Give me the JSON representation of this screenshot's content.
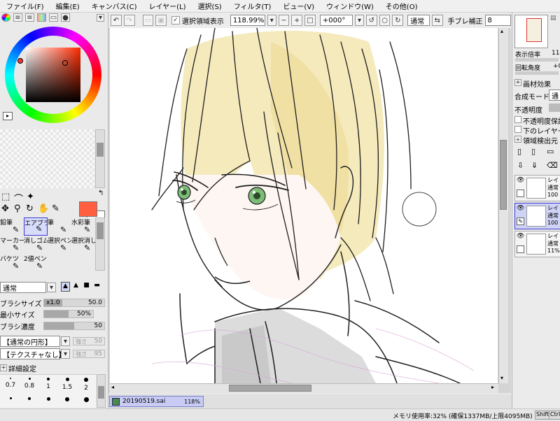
{
  "menubar": {
    "items": [
      "ファイル(F)",
      "編集(E)",
      "キャンバス(C)",
      "レイヤー(L)",
      "選択(S)",
      "フィルタ(T)",
      "ビュー(V)",
      "ウィンドウ(W)",
      "その他(O)"
    ]
  },
  "toolbar": {
    "selection_display_label": "選択領域表示",
    "zoom": "118.99%",
    "rotation": "+000°",
    "blend_mode": "通常",
    "stabilizer_label": "手ブレ補正",
    "stabilizer_value": "8"
  },
  "colors": {
    "primary": "#ff5e3f",
    "secondary": "#ffffff",
    "accent_selected": "#3c3cd0"
  },
  "tools": {
    "row1": [
      "鉛筆",
      "エアブラシ",
      "筆",
      "水彩筆"
    ],
    "row2": [
      "マーカー",
      "消しゴム",
      "選択ペン",
      "選択消し"
    ],
    "row3": [
      "バケツ",
      "2値ペン"
    ],
    "selected": "エアブラシ"
  },
  "brush": {
    "blend_mode": "通常",
    "size_label": "ブラシサイズ",
    "size_multiplier": "x1.0",
    "size_value": "50.0",
    "min_size_label": "最小サイズ",
    "min_size_value": "50%",
    "min_size_fill": 0.5,
    "density_label": "ブラシ濃度",
    "density_value": "50",
    "density_fill": 0.5,
    "shape_select": "【通常の円形】",
    "shape_strength_label": "強さ",
    "shape_strength_value": "50",
    "texture_select": "【テクスチャなし】",
    "texture_strength_label": "強さ",
    "texture_strength_value": "95",
    "details_label": "詳細設定",
    "presets_row1": [
      "0.7",
      "0.8",
      "1",
      "1.5",
      "2"
    ]
  },
  "right_panel": {
    "zoom_label": "表示倍率",
    "zoom_value": "118",
    "rotation_label": "回転角度",
    "rotation_value": "+0",
    "paper_effect_label": "画材効果",
    "blend_label": "合成モード",
    "blend_value": "通",
    "opacity_label": "不透明度",
    "opt_preserve_opacity": "不透明度保護",
    "opt_clip": "下のレイヤーで",
    "opt_source": "領域検出元",
    "layers": [
      {
        "name": "レイ",
        "mode": "通常",
        "opacity": "100"
      },
      {
        "name": "レイ",
        "mode": "通常",
        "opacity": "100"
      },
      {
        "name": "レイ",
        "mode": "通常",
        "opacity": "11%"
      }
    ]
  },
  "document_tab": {
    "filename": "20190519.sai",
    "zoom": "118%"
  },
  "statusbar": {
    "memory": "メモリ使用率:32% (確保1337MB/上限4095MB)",
    "keys": [
      "Shift",
      "Ctrl"
    ]
  }
}
